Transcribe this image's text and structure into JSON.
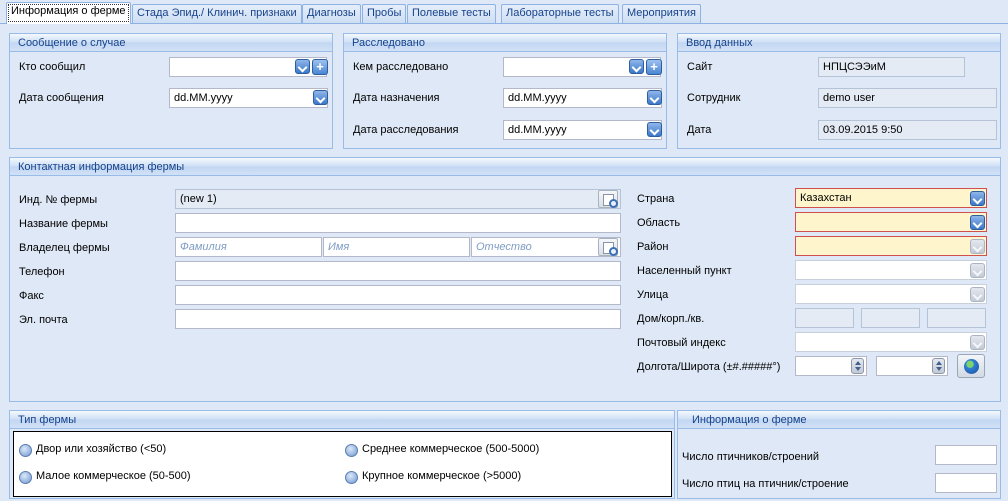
{
  "tabs": [
    {
      "label": "Информация о ферме",
      "active": true
    },
    {
      "label": "Стада Эпид./ Клинич. признаки"
    },
    {
      "label": "Диагнозы"
    },
    {
      "label": "Пробы"
    },
    {
      "label": "Полевые тесты"
    },
    {
      "label": "Лабораторные тесты"
    },
    {
      "label": "Мероприятия"
    }
  ],
  "notification": {
    "title": "Сообщение о случае",
    "reported_by_label": "Кто сообщил",
    "reported_by_value": "",
    "report_date_label": "Дата сообщения",
    "report_date_value": "dd.MM.yyyy"
  },
  "investigation": {
    "title": "Расследовано",
    "investigated_by_label": "Кем расследовано",
    "investigated_by_value": "",
    "assigned_date_label": "Дата назначения",
    "assigned_date_value": "dd.MM.yyyy",
    "investigation_date_label": "Дата расследования",
    "investigation_date_value": "dd.MM.yyyy"
  },
  "data_entry": {
    "title": "Ввод данных",
    "site_label": "Сайт",
    "site_value": "НПЦСЭЭиМ",
    "employee_label": "Сотрудник",
    "employee_value": "demo user",
    "date_label": "Дата",
    "date_value": "03.09.2015 9:50"
  },
  "contact": {
    "title": "Контактная информация фермы",
    "farm_id_label": "Инд. № фермы",
    "farm_id_value": "(new 1)",
    "farm_name_label": "Название фермы",
    "farm_name_value": "",
    "owner_label": "Владелец фермы",
    "owner_last_placeholder": "Фамилия",
    "owner_first_placeholder": "Имя",
    "owner_middle_placeholder": "Отчество",
    "phone_label": "Телефон",
    "phone_value": "",
    "fax_label": "Факс",
    "fax_value": "",
    "email_label": "Эл. почта",
    "email_value": "",
    "country_label": "Страна",
    "country_value": "Казахстан",
    "region_label": "Область",
    "region_value": "",
    "rayon_label": "Район",
    "rayon_value": "",
    "settlement_label": "Населенный пункт",
    "settlement_value": "",
    "street_label": "Улица",
    "street_value": "",
    "house_label": "Дом/корп./кв.",
    "postal_label": "Почтовый индекс",
    "postal_value": "",
    "coords_label": "Долгота/Широта (±#.#####°)"
  },
  "farm_type": {
    "title": "Тип фермы",
    "options": [
      "Двор или хозяйство (<50)",
      "Малое коммерческое  (50-500)",
      "Среднее коммерческое (500-5000)",
      "Крупное коммерческое (>5000)"
    ]
  },
  "farm_info": {
    "title": "Информация о ферме",
    "barns_label": "Число птичников/строений",
    "barns_value": "",
    "birds_label": "Число птиц на птичник/строение",
    "birds_value": ""
  }
}
